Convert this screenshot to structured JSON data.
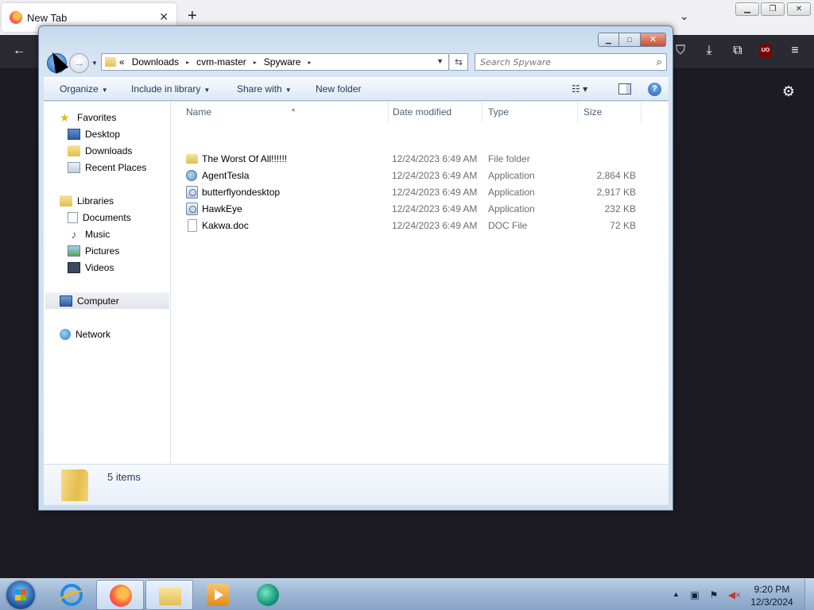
{
  "firefox": {
    "tab_title": "New Tab",
    "tab_close": "✕",
    "new_tab": "+",
    "list_all_tabs": "⌄",
    "caption_min": "▁",
    "caption_restore": "❐",
    "caption_close": "✕",
    "toolbar": {
      "back": "←",
      "pocket": "⛉",
      "download": "⤓",
      "extensions": "⧉",
      "ublock": "UO",
      "menu": "≡",
      "settings": "⚙"
    }
  },
  "explorer": {
    "window_min": "▁",
    "window_max": "□",
    "window_close": "✕",
    "nav": {
      "back": "←",
      "forward": "→",
      "history": "▼"
    },
    "address": {
      "overflow": "«",
      "crumbs": [
        "Downloads",
        "cvm-master",
        "Spyware"
      ],
      "separator": "▸",
      "dropdown": "▼",
      "refresh": "⇆"
    },
    "search": {
      "placeholder": "Search Spyware",
      "icon": "⌕"
    },
    "commands": {
      "organize": "Organize",
      "include": "Include in library",
      "share": "Share with",
      "new_folder": "New folder",
      "caret": "▼",
      "views": "☷ ▾",
      "help": "?"
    },
    "navpane": {
      "favorites": "Favorites",
      "desktop": "Desktop",
      "downloads": "Downloads",
      "recent": "Recent Places",
      "libraries": "Libraries",
      "documents": "Documents",
      "music": "Music",
      "pictures": "Pictures",
      "videos": "Videos",
      "computer": "Computer",
      "network": "Network"
    },
    "columns": {
      "name": "Name",
      "date": "Date modified",
      "type": "Type",
      "size": "Size",
      "sort": "▲"
    },
    "files": [
      {
        "name": "The Worst Of All!!!!!!",
        "date": "12/24/2023 6:49 AM",
        "type": "File folder",
        "size": "",
        "icon": "folder-icon"
      },
      {
        "name": "AgentTesla",
        "date": "12/24/2023 6:49 AM",
        "type": "Application",
        "size": "2,864 KB",
        "icon": "globe-app-icon"
      },
      {
        "name": "butterflyondesktop",
        "date": "12/24/2023 6:49 AM",
        "type": "Application",
        "size": "2,917 KB",
        "icon": "application-icon"
      },
      {
        "name": "HawkEye",
        "date": "12/24/2023 6:49 AM",
        "type": "Application",
        "size": "232 KB",
        "icon": "application-icon"
      },
      {
        "name": "Kakwa.doc",
        "date": "12/24/2023 6:49 AM",
        "type": "DOC File",
        "size": "72 KB",
        "icon": "document-icon"
      }
    ],
    "status": {
      "count": "5 items"
    }
  },
  "taskbar": {
    "clock_time": "9:20 PM",
    "clock_date": "12/3/2024",
    "tray_up": "▲",
    "tray_network": "▣",
    "tray_flag": "⚑",
    "tray_volume": "◀×"
  }
}
